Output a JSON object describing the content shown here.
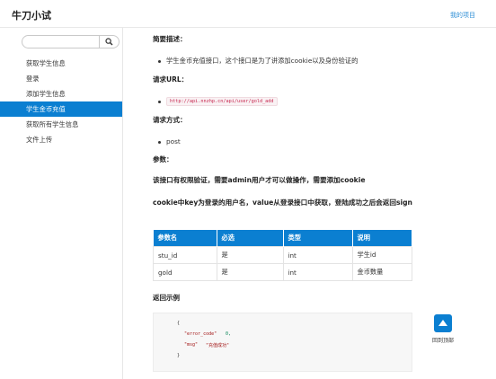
{
  "header": {
    "title": "牛刀小试",
    "my_project": "我的项目"
  },
  "sidebar": {
    "search_placeholder": "",
    "items": [
      {
        "label": "获取学生信息"
      },
      {
        "label": "登录"
      },
      {
        "label": "添加学生信息"
      },
      {
        "label": "学生金币充值"
      },
      {
        "label": "获取所有学生信息"
      },
      {
        "label": "文件上传"
      }
    ],
    "active_index": 3
  },
  "content": {
    "desc_title": "简要描述：",
    "desc_text": "学生金币充值接口，这个接口是为了讲添加cookie以及身份验证的",
    "url_title": "请求URL：",
    "url": "http://api.nnzhp.cn/api/user/gold_add",
    "method_title": "请求方式：",
    "method": "post",
    "params_title": "参数：",
    "note1": "该接口有权限验证，需要admin用户才可以做操作，需要添加cookie",
    "note2": "cookie中key为登录的用户名，value从登录接口中获取，登陆成功之后会返回sign",
    "table": {
      "headers": [
        "参数名",
        "必选",
        "类型",
        "说明"
      ],
      "rows": [
        [
          "stu_id",
          "是",
          "int",
          "学生id"
        ],
        [
          "gold",
          "是",
          "int",
          "金币数量"
        ]
      ]
    },
    "example_title": "返回示例",
    "code": {
      "open": "{",
      "key1": "\"error_code\"",
      "val1": "0,",
      "key2": "\"msg\"",
      "val2": "\"充值成功\"",
      "close": "}"
    }
  },
  "backtop": {
    "label": "回到顶部"
  },
  "colors": {
    "accent": "#0b7fd1",
    "link": "#2f8fd6"
  }
}
